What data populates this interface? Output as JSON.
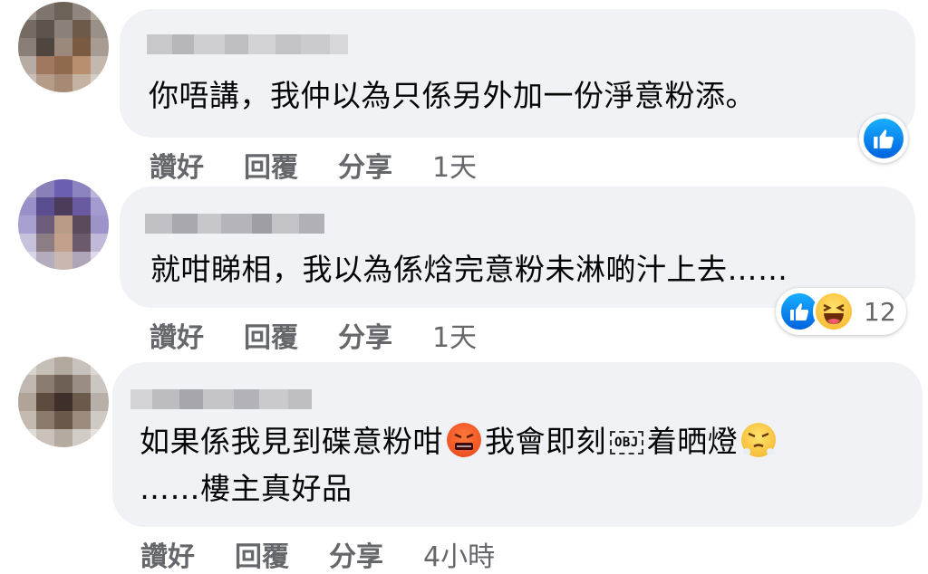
{
  "comments": [
    {
      "text": "你唔講，我仲以為只係另外加一份淨意粉添。",
      "actions": {
        "like": "讚好",
        "reply": "回覆",
        "share": "分享",
        "time": "1天"
      }
    },
    {
      "text": "就咁睇相，我以為係焓完意粉未淋啲汁上去……",
      "actions": {
        "like": "讚好",
        "reply": "回覆",
        "share": "分享",
        "time": "1天"
      },
      "reactions": {
        "count": "12"
      }
    },
    {
      "text_line1_a": "如果係我見到碟意粉咁",
      "text_line1_b": "我會即刻",
      "obj": "OBJ",
      "text_line1_c": "着晒燈",
      "text_line2": "……樓主真好品",
      "actions": {
        "like": "讚好",
        "reply": "回覆",
        "share": "分享",
        "time": "4小時"
      }
    }
  ],
  "colors": {
    "bubble": "#f0f2f5",
    "meta_text": "#65676b",
    "like_blue": "#1877f2"
  }
}
